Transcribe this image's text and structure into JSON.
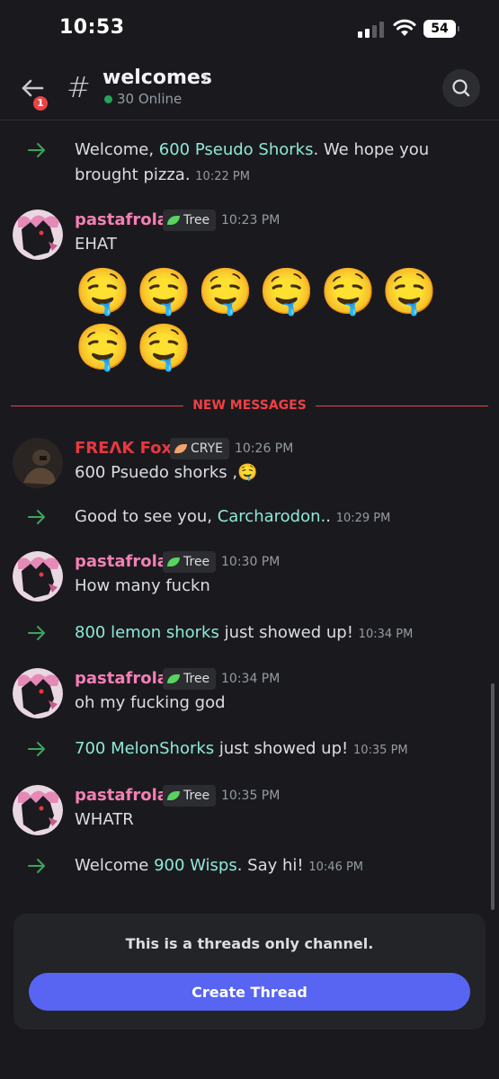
{
  "status_bar": {
    "time": "10:53",
    "battery": "54"
  },
  "header": {
    "back_badge": "1",
    "channel_name": "welcomes",
    "online": "30 Online"
  },
  "messages": {
    "m1": {
      "prefix": "Welcome, ",
      "highlight": "600 Pseudo Shorks",
      "suffix": ". We hope you brought pizza.",
      "time": "10:22 PM"
    },
    "m2": {
      "user": "pastafrola",
      "role": "Tree",
      "time": "10:23 PM",
      "text": "EHAT",
      "emoji_line1": "🤤🤤🤤🤤🤤🤤",
      "emoji_line2": "🤤🤤"
    },
    "divider": "NEW MESSAGES",
    "m3": {
      "user": "FREΛK Fox",
      "role": "CRYE",
      "time": "10:26 PM",
      "text": "600 Psuedo shorks ,🤤"
    },
    "m4": {
      "prefix": "Good to see you, ",
      "highlight": "Carcharodon.",
      "suffix": ".",
      "time": "10:29 PM"
    },
    "m5": {
      "user": "pastafrola",
      "role": "Tree",
      "time": "10:30 PM",
      "text": "How many fuckn"
    },
    "m6": {
      "prefix": "",
      "highlight": "800 lemon shorks",
      "suffix": " just showed up!",
      "time": "10:34 PM"
    },
    "m7": {
      "user": "pastafrola",
      "role": "Tree",
      "time": "10:34 PM",
      "text": "oh my fucking god"
    },
    "m8": {
      "prefix": "",
      "highlight": "700 MelonShorks",
      "suffix": " just showed up!",
      "time": "10:35 PM"
    },
    "m9": {
      "user": "pastafrola",
      "role": "Tree",
      "time": "10:35 PM",
      "text": "WHATR"
    },
    "m10": {
      "prefix": "Welcome ",
      "highlight": "900 Wisps",
      "suffix": ". Say hi!",
      "time": "10:46 PM"
    }
  },
  "composer": {
    "info": "This is a threads only channel.",
    "button": "Create Thread"
  },
  "colors": {
    "accent": "#5865f2",
    "username_pink": "#f47fb4",
    "username_red": "#e8383f",
    "highlight": "#8fe8d8",
    "new_messages": "#f23f43",
    "online": "#23a55a",
    "join_arrow": "#3ba55c"
  },
  "icons": [
    "back-arrow-icon",
    "hash-icon",
    "chevron-right-icon",
    "search-icon",
    "join-arrow-icon",
    "leaf-icon",
    "cellular-icon",
    "wifi-icon"
  ]
}
